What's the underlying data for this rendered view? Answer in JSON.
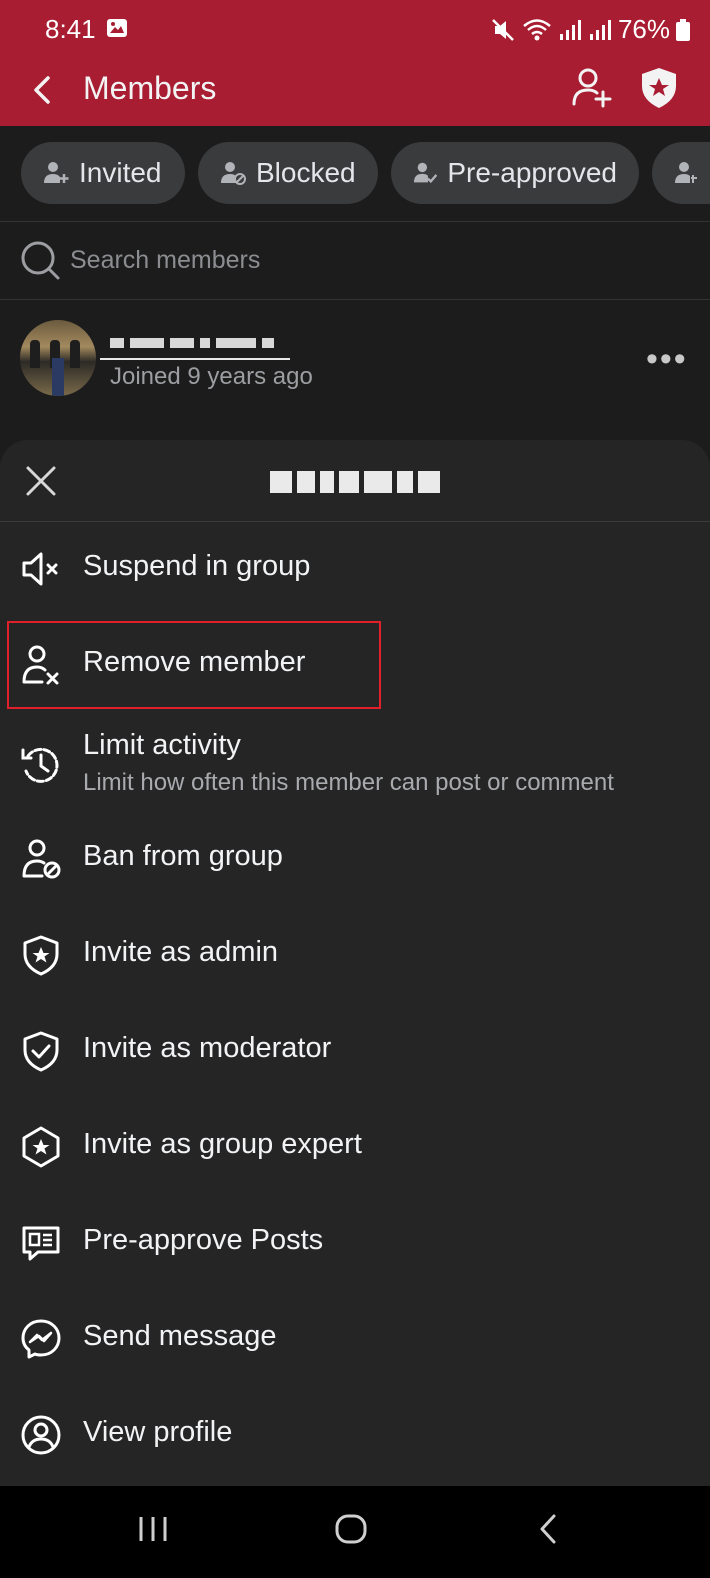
{
  "status_bar": {
    "time": "8:41",
    "battery": "76%"
  },
  "app_bar": {
    "title": "Members"
  },
  "chips": [
    {
      "label": "Invited"
    },
    {
      "label": "Blocked"
    },
    {
      "label": "Pre-approved"
    }
  ],
  "search": {
    "placeholder": "Search members"
  },
  "member": {
    "joined": "Joined 9 years ago"
  },
  "sheet": {
    "items": [
      {
        "label": "Suspend in group",
        "icon": "speaker-mute-icon"
      },
      {
        "label": "Remove member",
        "icon": "remove-user-icon"
      },
      {
        "label": "Limit activity",
        "subtitle": "Limit how often this member can post or comment",
        "icon": "clock-history-icon"
      },
      {
        "label": "Ban from group",
        "icon": "ban-user-icon"
      },
      {
        "label": "Invite as admin",
        "icon": "shield-star-icon"
      },
      {
        "label": "Invite as moderator",
        "icon": "shield-check-icon"
      },
      {
        "label": "Invite as group expert",
        "icon": "badge-star-icon"
      },
      {
        "label": "Pre-approve Posts",
        "icon": "post-card-icon"
      },
      {
        "label": "Send message",
        "icon": "messenger-icon"
      },
      {
        "label": "View profile",
        "icon": "profile-circle-icon"
      }
    ]
  },
  "colors": {
    "app_bar": "#a91d32",
    "background": "#1c1c1d",
    "sheet": "#252526",
    "highlight": "#e0202a"
  }
}
